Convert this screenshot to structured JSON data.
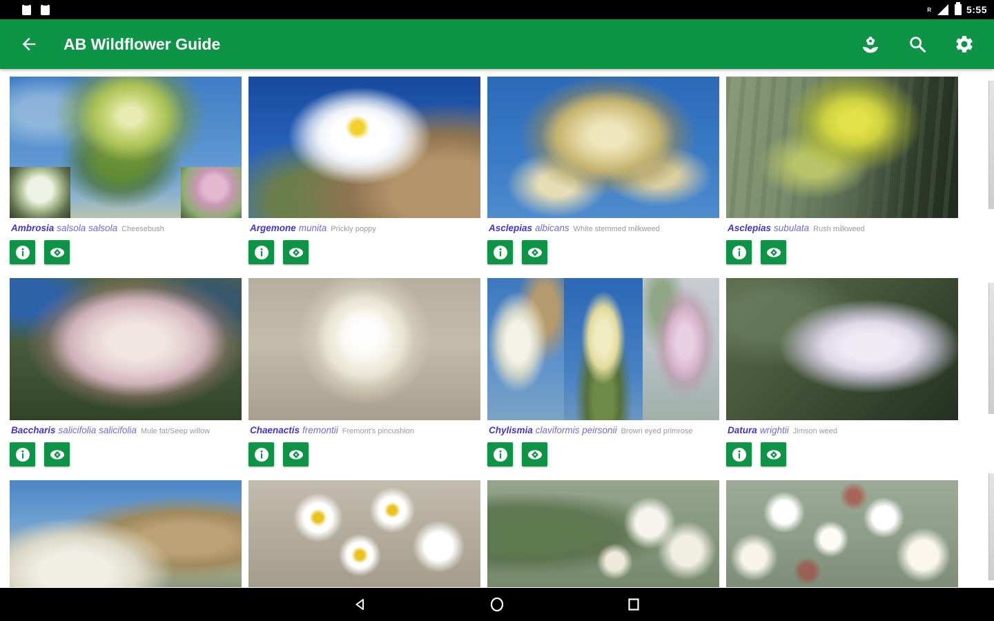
{
  "status_bar": {
    "time": "5:55",
    "roaming_indicator": "R"
  },
  "app_bar": {
    "title": "AB Wildflower Guide",
    "icons": {
      "back": "arrow-left",
      "flower": "flower-filter",
      "search": "magnifier",
      "settings": "gear"
    }
  },
  "colors": {
    "app_bar_green": "#0E9447",
    "button_green": "#0E9447",
    "genus_purple": "#4136C9",
    "species_purple": "#7568E0",
    "common_gray": "#9A9A9A"
  },
  "cards": [
    {
      "genus": "Ambrosia",
      "species": "salsola salsola",
      "common": "Cheesebush"
    },
    {
      "genus": "Argemone",
      "species": "munita",
      "common": "Prickly poppy"
    },
    {
      "genus": "Asclepias",
      "species": "albicans",
      "common": "White stemmed milkweed"
    },
    {
      "genus": "Asclepias",
      "species": "subulata",
      "common": "Rush milkweed"
    },
    {
      "genus": "Baccharis",
      "species": "salicifolia salicifolia",
      "common": "Mule fat/Seep willow"
    },
    {
      "genus": "Chaenactis",
      "species": "fremontii",
      "common": "Fremont's pincushion"
    },
    {
      "genus": "Chylismia",
      "species": "claviformis peirsonii",
      "common": "Brown eyed primrose"
    },
    {
      "genus": "Datura",
      "species": "wrightii",
      "common": "Jimson weed"
    }
  ],
  "card_buttons": {
    "info": "info-button",
    "photos": "eye-button"
  },
  "nav_bar": {
    "buttons": [
      "back",
      "home",
      "recents"
    ]
  }
}
